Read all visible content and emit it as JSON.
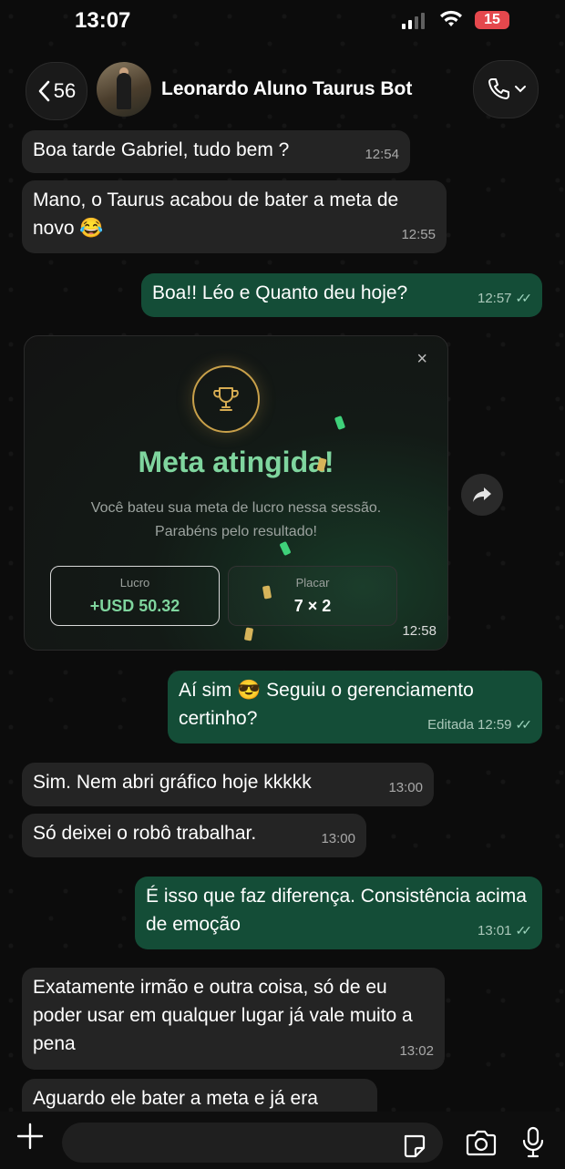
{
  "status_bar": {
    "time": "13:07",
    "battery": "15"
  },
  "header": {
    "back_count": "56",
    "contact_name": "Leonardo Aluno Taurus Bot"
  },
  "messages": [
    {
      "dir": "in",
      "text": "Boa tarde Gabriel, tudo bem ?",
      "time": "12:54"
    },
    {
      "dir": "in",
      "text": "Mano, o Taurus acabou de bater a meta de novo 😂",
      "time": "12:55"
    },
    {
      "dir": "out",
      "text": "Boa!! Léo e Quanto deu hoje?",
      "time": "12:57"
    },
    {
      "dir": "out",
      "text": "Aí sim 😎 Seguiu o gerenciamento certinho?",
      "time": "12:59",
      "edited": "Editada"
    },
    {
      "dir": "in",
      "text": "Sim. Nem abri gráfico hoje kkkkk",
      "time": "13:00"
    },
    {
      "dir": "in",
      "text": "Só deixei o robô trabalhar.",
      "time": "13:00"
    },
    {
      "dir": "out",
      "text": "É isso que faz diferença. Consistência acima de emoção",
      "time": "13:01"
    },
    {
      "dir": "in",
      "text": "Exatamente irmão e outra coisa, só de eu poder usar em qualquer lugar já vale muito a pena",
      "time": "13:02"
    },
    {
      "dir": "in",
      "text": "Aguardo ele bater a meta e já era",
      "time": ""
    }
  ],
  "image_card": {
    "title": "Meta atingida!",
    "subtitle": "Você bateu sua meta de lucro nessa sessão. Parabéns pelo resultado!",
    "stat1_label": "Lucro",
    "stat1_value": "+USD 50.32",
    "stat2_label": "Placar",
    "stat2_value": "7 × 2",
    "close": "×",
    "time": "12:58"
  },
  "colors": {
    "incoming": "#242424",
    "outgoing": "#144d37",
    "accent_green": "#7fd59e",
    "gold": "#c8a04a"
  },
  "icons": [
    "back-chevron-icon",
    "phone-icon",
    "chevron-down-icon",
    "trophy-icon",
    "forward-icon",
    "plus-icon",
    "sticker-icon",
    "camera-icon",
    "mic-icon",
    "double-check-icon",
    "wifi-icon",
    "signal-icon"
  ]
}
